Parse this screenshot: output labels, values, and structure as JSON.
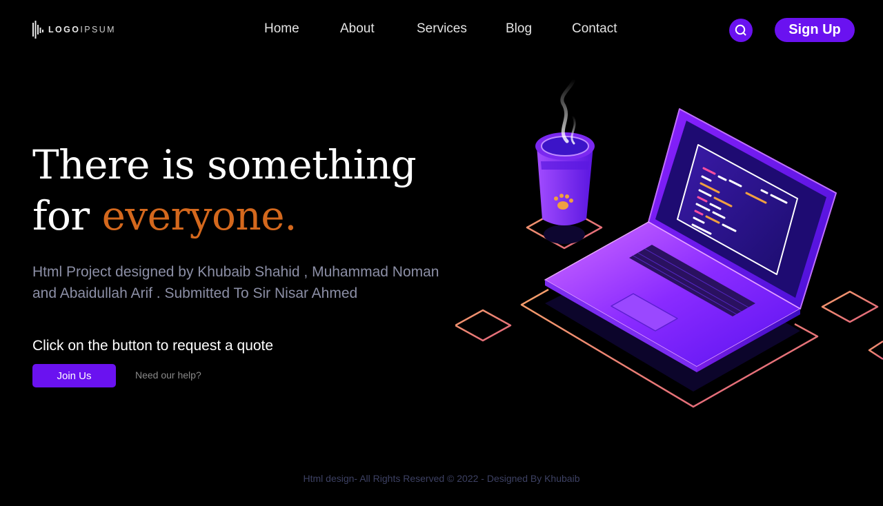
{
  "logo": {
    "icon": "soundwave-logo-icon",
    "text_bold": "LOGO",
    "text_light": "IPSUM"
  },
  "nav": {
    "items": [
      {
        "label": "Home"
      },
      {
        "label": "About"
      },
      {
        "label": "Services"
      },
      {
        "label": "Blog"
      },
      {
        "label": "Contact"
      }
    ]
  },
  "header": {
    "search_icon": "search-icon",
    "signup_label": "Sign Up"
  },
  "hero": {
    "title_line1": "There is something",
    "title_for": "for ",
    "title_accent": "everyone.",
    "subtitle": "Html Project designed by Khubaib Shahid , Muhammad Noman and Abaidullah Arif . Submitted To Sir Nisar Ahmed",
    "cta_text": "Click on the button to request a quote",
    "join_label": "Join Us",
    "help_label": "Need our help?"
  },
  "footer": {
    "text": "Html design- All Rights Reserved © 2022 - Designed By Khubaib"
  },
  "colors": {
    "background": "#000000",
    "accent_purple": "#6a12f0",
    "accent_orange": "#d4681d",
    "muted_text": "#8c8fa6",
    "footer_text": "#3d4163"
  }
}
